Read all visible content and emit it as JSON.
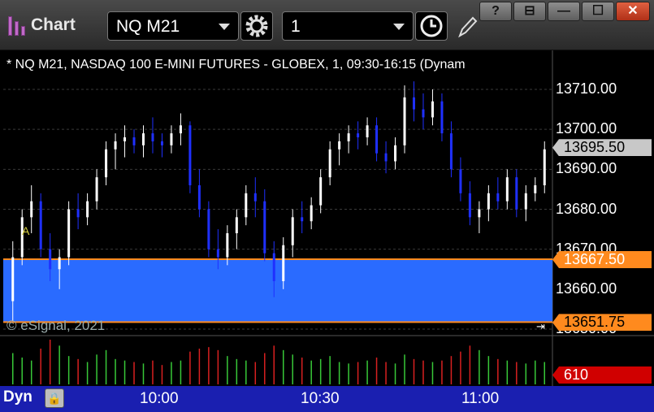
{
  "window": {
    "app_title": "Chart",
    "icons": [
      "app-bars-icon",
      "gear-icon",
      "clock-icon",
      "pencil-icon"
    ],
    "window_buttons": [
      "?",
      "⊟",
      "—",
      "☐",
      "✕"
    ]
  },
  "toolbar": {
    "symbol_value": "NQ M21",
    "interval_value": "1"
  },
  "chart": {
    "title": "* NQ M21, NASDAQ 100 E-MINI FUTURES - GLOBEX, 1, 09:30-16:15 (Dynam",
    "copyright": "© eSignal, 2021",
    "marker": "A",
    "colors": {
      "up": "#ffffff",
      "down": "#1f30ff",
      "band_fill": "#2a6bff",
      "band_line": "#ff8a1e",
      "current_price_tag": "#c8c8c8",
      "volume_up": "#38c838",
      "volume_down": "#d82020",
      "footer": "#1a1fb0"
    }
  },
  "price_axis": {
    "ticks": [
      "13710.00",
      "13700.00",
      "13690.00",
      "13680.00",
      "13670.00",
      "13660.00",
      "13650.00"
    ],
    "last_price": "13695.50",
    "band_upper": "13667.50",
    "band_lower": "13651.75",
    "volume_last": "610"
  },
  "time_axis": {
    "labels": [
      "10:00",
      "10:30",
      "11:00"
    ]
  },
  "footer": {
    "mode_label": "Dyn"
  },
  "chart_data": {
    "type": "candlestick",
    "series": [
      {
        "name": "NQ M21",
        "values": [
          [
            13657,
            13672,
            13652,
            13668
          ],
          [
            13668,
            13680,
            13666,
            13678
          ],
          [
            13678,
            13686,
            13674,
            13682
          ],
          [
            13682,
            13684,
            13668,
            13670
          ],
          [
            13670,
            13674,
            13662,
            13665
          ],
          [
            13665,
            13670,
            13660,
            13668
          ],
          [
            13668,
            13682,
            13666,
            13680
          ],
          [
            13680,
            13684,
            13675,
            13678
          ],
          [
            13678,
            13684,
            13676,
            13682
          ],
          [
            13682,
            13690,
            13680,
            13688
          ],
          [
            13688,
            13697,
            13686,
            13695
          ],
          [
            13695,
            13699,
            13690,
            13697
          ],
          [
            13697,
            13701,
            13693,
            13698
          ],
          [
            13698,
            13700,
            13694,
            13696
          ],
          [
            13696,
            13701,
            13693,
            13699
          ],
          [
            13699,
            13703,
            13694,
            13697
          ],
          [
            13697,
            13699,
            13693,
            13696
          ],
          [
            13696,
            13701,
            13694,
            13699
          ],
          [
            13699,
            13704,
            13696,
            13701
          ],
          [
            13701,
            13702,
            13684,
            13686
          ],
          [
            13686,
            13690,
            13678,
            13680
          ],
          [
            13680,
            13682,
            13668,
            13670
          ],
          [
            13670,
            13675,
            13665,
            13668
          ],
          [
            13668,
            13676,
            13666,
            13674
          ],
          [
            13674,
            13680,
            13670,
            13678
          ],
          [
            13678,
            13686,
            13676,
            13684
          ],
          [
            13684,
            13688,
            13678,
            13682
          ],
          [
            13682,
            13685,
            13667,
            13669
          ],
          [
            13669,
            13672,
            13658,
            13662
          ],
          [
            13662,
            13673,
            13660,
            13671
          ],
          [
            13671,
            13680,
            13668,
            13678
          ],
          [
            13678,
            13682,
            13674,
            13677
          ],
          [
            13677,
            13683,
            13675,
            13681
          ],
          [
            13681,
            13690,
            13679,
            13688
          ],
          [
            13688,
            13697,
            13686,
            13695
          ],
          [
            13695,
            13699,
            13691,
            13697
          ],
          [
            13697,
            13701,
            13694,
            13699
          ],
          [
            13699,
            13702,
            13695,
            13698
          ],
          [
            13698,
            13703,
            13696,
            13701
          ],
          [
            13701,
            13703,
            13692,
            13694
          ],
          [
            13694,
            13697,
            13689,
            13692
          ],
          [
            13692,
            13698,
            13690,
            13696
          ],
          [
            13696,
            13711,
            13694,
            13708
          ],
          [
            13708,
            13712,
            13702,
            13705
          ],
          [
            13705,
            13709,
            13700,
            13703
          ],
          [
            13703,
            13710,
            13701,
            13707
          ],
          [
            13707,
            13709,
            13697,
            13699
          ],
          [
            13699,
            13702,
            13688,
            13690
          ],
          [
            13690,
            13693,
            13682,
            13684
          ],
          [
            13684,
            13687,
            13676,
            13678
          ],
          [
            13678,
            13682,
            13674,
            13680
          ],
          [
            13680,
            13686,
            13677,
            13684
          ],
          [
            13684,
            13688,
            13680,
            13682
          ],
          [
            13682,
            13690,
            13680,
            13688
          ],
          [
            13688,
            13690,
            13678,
            13680
          ],
          [
            13680,
            13686,
            13677,
            13684
          ],
          [
            13684,
            13688,
            13682,
            13686
          ],
          [
            13686,
            13697,
            13684,
            13695
          ]
        ]
      }
    ],
    "volume": [
      210,
      180,
      160,
      240,
      300,
      260,
      190,
      170,
      150,
      200,
      230,
      170,
      160,
      150,
      140,
      160,
      130,
      150,
      160,
      220,
      240,
      250,
      230,
      190,
      170,
      160,
      150,
      210,
      260,
      230,
      200,
      180,
      160,
      170,
      190,
      150,
      140,
      150,
      160,
      180,
      150,
      140,
      200,
      170,
      160,
      150,
      160,
      190,
      220,
      260,
      230,
      190,
      170,
      160,
      150,
      140,
      160,
      150
    ],
    "ylim": [
      13645,
      13720
    ],
    "x_axis_labels": [
      "10:00",
      "10:30",
      "11:00"
    ],
    "band": {
      "upper": 13667.5,
      "lower": 13651.75
    },
    "last": 13695.5
  }
}
